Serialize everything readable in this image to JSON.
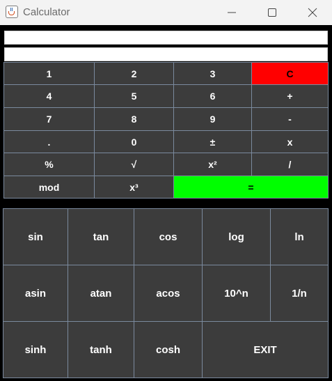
{
  "window": {
    "title": "Calculator",
    "icon": "java-cup-icon"
  },
  "display": {
    "expression": "",
    "result": ""
  },
  "keypad": {
    "rows": [
      [
        "1",
        "2",
        "3",
        "C"
      ],
      [
        "4",
        "5",
        "6",
        "+"
      ],
      [
        "7",
        "8",
        "9",
        "-"
      ],
      [
        ".",
        "0",
        "±",
        "x"
      ],
      [
        "%",
        "√",
        "x²",
        "/"
      ],
      [
        "mod",
        "x³",
        "="
      ]
    ]
  },
  "scientific": {
    "rows": [
      [
        "sin",
        "tan",
        "cos",
        "log",
        "ln"
      ],
      [
        "asin",
        "atan",
        "acos",
        "10^n",
        "1/n"
      ],
      [
        "sinh",
        "tanh",
        "cosh",
        "EXIT"
      ]
    ]
  },
  "colors": {
    "clear_button": "#ff0000",
    "equals_button": "#00ff00",
    "button_bg": "#3c3c3c",
    "button_border": "#7b8a9e",
    "background": "#000000"
  }
}
